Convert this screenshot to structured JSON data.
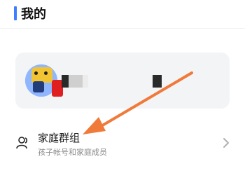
{
  "header": {
    "title": "我的",
    "accent_color": "#3d7fff"
  },
  "profile": {
    "avatar_icon": "cartoon-avatar-icon"
  },
  "family_group": {
    "label": "家庭群组",
    "subtitle": "孩子帐号和家庭成员",
    "icon": "family-user-icon",
    "chevron": "chevron-right-icon"
  },
  "annotation": {
    "color": "#f07a3a",
    "icon": "arrow-pointer-icon"
  }
}
